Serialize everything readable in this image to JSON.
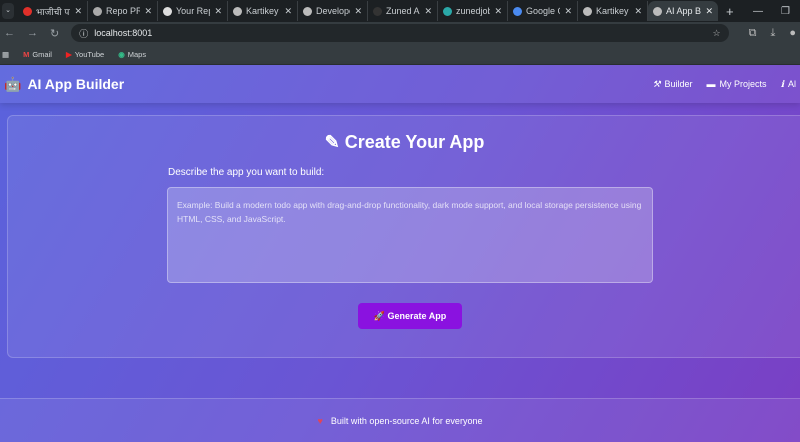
{
  "browser": {
    "tabs": [
      {
        "label": "भाजीची पा",
        "icon": "youtube-icon",
        "color": "#e0302a"
      },
      {
        "label": "Repo PR D",
        "icon": "app-icon",
        "color": "#aaaaaa"
      },
      {
        "label": "Your Repo",
        "icon": "github-icon",
        "color": "#dddddd"
      },
      {
        "label": "Kartikey S",
        "icon": "globe-icon",
        "color": "#bbbbbb"
      },
      {
        "label": "Developer",
        "icon": "globe-icon",
        "color": "#bbbbbb"
      },
      {
        "label": "Zuned Au",
        "icon": "za-icon",
        "color": "#333333"
      },
      {
        "label": "zunedjobs",
        "icon": "gear-icon",
        "color": "#2aa8a8"
      },
      {
        "label": "Google Ge",
        "icon": "gemini-icon",
        "color": "#4a8af0"
      },
      {
        "label": "Kartikey S",
        "icon": "globe-icon",
        "color": "#bbbbbb"
      },
      {
        "label": "AI App Bu",
        "icon": "globe-icon",
        "color": "#bbbbbb",
        "active": true
      }
    ],
    "url": "localhost:8001",
    "bookmarks": [
      "Gmail",
      "YouTube",
      "Maps"
    ]
  },
  "app": {
    "logo": "AI App Builder",
    "nav": [
      "Builder",
      "My Projects",
      "Al"
    ],
    "title": "Create Your App",
    "prompt_label": "Describe the app you want to build:",
    "placeholder": "Example: Build a modern todo app with drag-and-drop functionality, dark mode support, and local storage persistence using HTML, CSS, and JavaScript.",
    "generate": "Generate App",
    "footer": "Built with open-source AI for everyone"
  }
}
